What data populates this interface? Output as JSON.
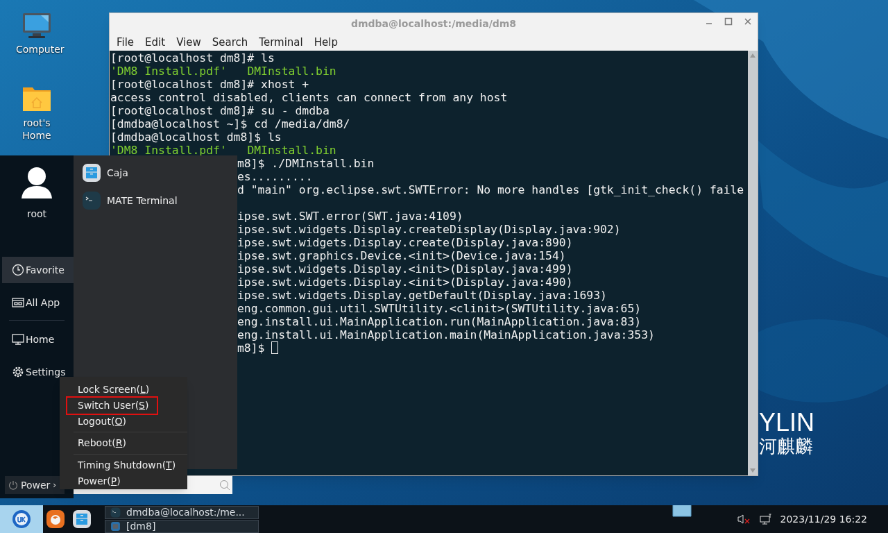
{
  "desktop": {
    "icons": [
      {
        "label": "Computer",
        "kind": "computer"
      },
      {
        "label": "root's Home",
        "kind": "home"
      }
    ],
    "logo": {
      "text": "YLIN",
      "subtext": "河麒麟"
    }
  },
  "terminal": {
    "title": "dmdba@localhost:/media/dm8",
    "menu": [
      "File",
      "Edit",
      "View",
      "Search",
      "Terminal",
      "Help"
    ],
    "lines": [
      [
        {
          "text": "[root@localhost dm8]# ls",
          "kind": "plain"
        }
      ],
      [
        {
          "text": "'DM8 Install.pdf'   ",
          "kind": "file"
        },
        {
          "text": "DMInstall.bin",
          "kind": "file"
        }
      ],
      [
        {
          "text": "[root@localhost dm8]# xhost +",
          "kind": "plain"
        }
      ],
      [
        {
          "text": "access control disabled, clients can connect from any host",
          "kind": "plain"
        }
      ],
      [
        {
          "text": "[root@localhost dm8]# su - dmdba",
          "kind": "plain"
        }
      ],
      [
        {
          "text": "[dmdba@localhost ~]$ cd /media/dm8/",
          "kind": "plain"
        }
      ],
      [
        {
          "text": "[dmdba@localhost dm8]$ ls",
          "kind": "plain"
        }
      ],
      [
        {
          "text": "'DM8 Install.pdf'   ",
          "kind": "file"
        },
        {
          "text": "DMInstall.bin",
          "kind": "file"
        }
      ],
      [
        {
          "text": "m8]$ ./DMInstall.bin",
          "kind": "covered"
        }
      ],
      [
        {
          "text": "es.........",
          "kind": "covered"
        }
      ],
      [
        {
          "text": "d \"main\" org.eclipse.swt.SWTError: No more handles [gtk_init_check() faile",
          "kind": "covered"
        }
      ],
      [
        {
          "text": "ipse.swt.SWT.error(SWT.java:4109)",
          "kind": "covered_gap"
        }
      ],
      [
        {
          "text": "ipse.swt.widgets.Display.createDisplay(Display.java:902)",
          "kind": "covered"
        }
      ],
      [
        {
          "text": "ipse.swt.widgets.Display.create(Display.java:890)",
          "kind": "covered"
        }
      ],
      [
        {
          "text": "ipse.swt.graphics.Device.<init>(Device.java:154)",
          "kind": "covered"
        }
      ],
      [
        {
          "text": "ipse.swt.widgets.Display.<init>(Display.java:499)",
          "kind": "covered"
        }
      ],
      [
        {
          "text": "ipse.swt.widgets.Display.<init>(Display.java:490)",
          "kind": "covered"
        }
      ],
      [
        {
          "text": "ipse.swt.widgets.Display.getDefault(Display.java:1693)",
          "kind": "covered"
        }
      ],
      [
        {
          "text": "eng.common.gui.util.SWTUtility.<clinit>(SWTUtility.java:65)",
          "kind": "covered"
        }
      ],
      [
        {
          "text": "eng.install.ui.MainApplication.run(MainApplication.java:83)",
          "kind": "covered"
        }
      ],
      [
        {
          "text": "eng.install.ui.MainApplication.main(MainApplication.java:353)",
          "kind": "covered"
        }
      ],
      [
        {
          "text": "m8]$ ",
          "kind": "covered"
        }
      ]
    ],
    "cursor": true
  },
  "start_menu": {
    "user": "root",
    "nav": [
      {
        "label": "Favorite",
        "selected": true
      },
      {
        "label": "All App",
        "selected": false
      },
      {
        "label": "Home",
        "selected": false
      },
      {
        "label": "Settings",
        "selected": false
      }
    ],
    "apps": [
      {
        "label": "Caja",
        "kind": "files"
      },
      {
        "label": "MATE Terminal",
        "kind": "terminal"
      }
    ],
    "power_button": "Power",
    "power_arrow": "›"
  },
  "power_menu": {
    "groups": [
      [
        {
          "before": "Lock Screen(",
          "key": "L",
          "after": ")",
          "highlighted": false
        },
        {
          "before": "Switch User(",
          "key": "S",
          "after": ")",
          "highlighted": true
        },
        {
          "before": "Logout(",
          "key": "O",
          "after": ")",
          "highlighted": false
        }
      ],
      [
        {
          "before": "Reboot(",
          "key": "R",
          "after": ")",
          "highlighted": false
        }
      ],
      [
        {
          "before": "Timing Shutdown(",
          "key": "T",
          "after": ")",
          "highlighted": false
        },
        {
          "before": "Power(",
          "key": "P",
          "after": ")",
          "highlighted": false
        }
      ]
    ]
  },
  "taskbar": {
    "tasks": [
      {
        "label": "dmdba@localhost:/me...",
        "kind": "terminal"
      },
      {
        "label": "[dm8]",
        "kind": "drive"
      }
    ],
    "volume_muted": true,
    "clock": "2023/11/29 16:22"
  }
}
